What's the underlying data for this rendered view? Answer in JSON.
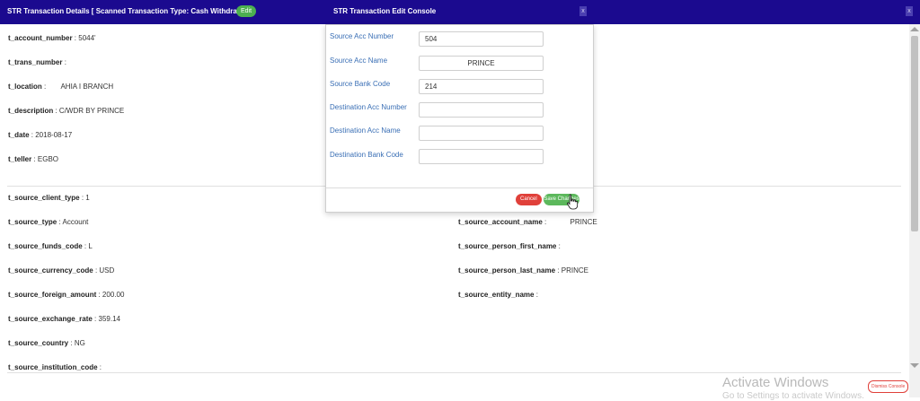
{
  "header": {
    "title": "STR Transaction Details [ Scanned Transaction Type: Cash Withdrawal ]",
    "edit_label": "Edit",
    "close_glyph": "x"
  },
  "modal": {
    "title": "STR Transaction Edit Console",
    "close_glyph": "x",
    "fields": [
      {
        "label": "Source Acc Number",
        "value": "504"
      },
      {
        "label": "Source Acc Name",
        "value": "PRINCE"
      },
      {
        "label": "Source Bank Code",
        "value": "214"
      },
      {
        "label": "Destination Acc Number",
        "value": ""
      },
      {
        "label": "Destination Acc Name",
        "value": ""
      },
      {
        "label": "Destination Bank Code",
        "value": ""
      }
    ],
    "cancel_label": "Cancel",
    "save_label": "Save Changes"
  },
  "details_left": [
    {
      "key": "t_account_number",
      "value": "5044'"
    },
    {
      "key": "t_trans_number",
      "value": ""
    },
    {
      "key": "t_location",
      "value": "AHIA I BRANCH"
    },
    {
      "key": "t_description",
      "value": "C/WDR BY PRINCE"
    },
    {
      "key": "t_date",
      "value": "2018-08-17"
    },
    {
      "key": "t_teller",
      "value": "EGBO"
    }
  ],
  "source_left": [
    {
      "key": "t_source_client_type",
      "value": "1"
    },
    {
      "key": "t_source_type",
      "value": "Account"
    },
    {
      "key": "t_source_funds_code",
      "value": "L"
    },
    {
      "key": "t_source_currency_code",
      "value": "USD"
    },
    {
      "key": "t_source_foreign_amount",
      "value": "200.00"
    },
    {
      "key": "t_source_exchange_rate",
      "value": "359.14"
    },
    {
      "key": "t_source_country",
      "value": "NG"
    },
    {
      "key": "t_source_institution_code",
      "value": ""
    }
  ],
  "source_right": [
    {
      "key": "t_source_account_name",
      "value": "PRINCE"
    },
    {
      "key": "t_source_person_first_name",
      "value": ""
    },
    {
      "key": "t_source_person_last_name",
      "value": "PRINCE"
    },
    {
      "key": "t_source_entity_name",
      "value": ""
    }
  ],
  "sep": " : ",
  "watermark": {
    "title": "Activate Windows",
    "subtitle": "Go to Settings to activate Windows."
  },
  "dismiss_label": "Dismiss Console",
  "colors": {
    "header_bg": "#1b0a8f",
    "label_blue": "#3a6fb5",
    "save_green": "#5cb85c",
    "cancel_red": "#e0403a"
  }
}
